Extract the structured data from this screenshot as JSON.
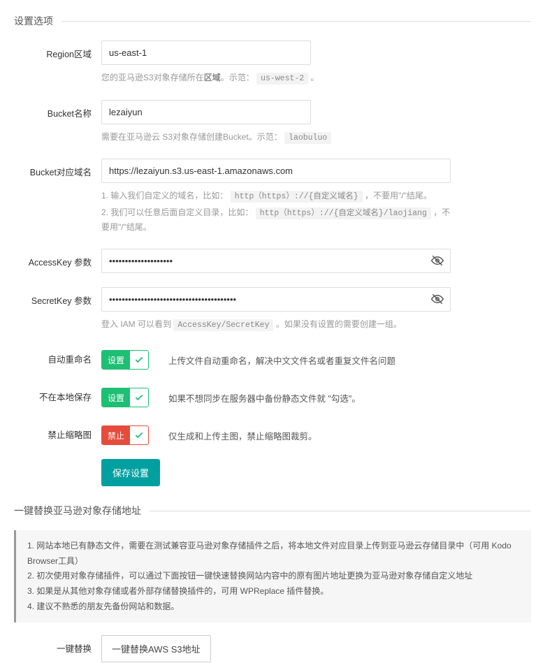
{
  "section1_title": "设置选项",
  "region": {
    "label": "Region区域",
    "value": "us-east-1",
    "hint_pre": "您的亚马逊S3对象存储所在",
    "hint_bold": "区域",
    "hint_post": "。示范：",
    "hint_code": "us-west-2",
    "hint_end": "。"
  },
  "bucket": {
    "label": "Bucket名称",
    "value": "lezaiyun",
    "hint_pre": "需要在亚马逊云 S3对象存储创建Bucket。示范：",
    "hint_code": "laobuluo"
  },
  "domain": {
    "label": "Bucket对应域名",
    "value": "https://lezaiyun.s3.us-east-1.amazonaws.com",
    "hint1_pre": "输入我们自定义的域名，比如：",
    "hint1_code": "http（https）://{自定义域名}",
    "hint1_post": "，不要用\"/\"结尾。",
    "hint2_pre": "我们可以任意后面自定义目录，比如：",
    "hint2_code": "http（https）://{自定义域名}/laojiang",
    "hint2_post": "，不要用\"/\"结尾。"
  },
  "access_key": {
    "label": "AccessKey 参数",
    "value": "••••••••••••••••••••"
  },
  "secret_key": {
    "label": "SecretKey 参数",
    "value": "••••••••••••••••••••••••••••••••••••••••",
    "hint_pre": "登入 IAM 可以看到",
    "hint_code": "AccessKey/SecretKey",
    "hint_post": "。如果没有设置的需要创建一组。"
  },
  "auto_rename": {
    "label": "自动重命名",
    "toggle": "设置",
    "desc": "上传文件自动重命名，解决中文文件名或者重复文件名问题"
  },
  "no_local": {
    "label": "不在本地保存",
    "toggle": "设置",
    "desc": "如果不想同步在服务器中备份静态文件就 \"勾选\"。"
  },
  "no_thumb": {
    "label": "禁止缩略图",
    "toggle": "禁止",
    "desc": "仅生成和上传主图，禁止缩略图裁剪。"
  },
  "save_btn": "保存设置",
  "section2_title": "一键替换亚马逊对象存储地址",
  "info_list": {
    "i1": "网站本地已有静态文件，需要在测试兼容亚马逊对象存储插件之后，将本地文件对应目录上传到亚马逊云存储目录中（可用 Kodo Browser工具）",
    "i2": "初次使用对象存储插件，可以通过下面按钮一键快速替换网站内容中的原有图片地址更换为亚马逊对象存储自定义地址",
    "i3": "如果是从其他对象存储或者外部存储替换插件的，可用 WPReplace 插件替换。",
    "i4": "建议不熟悉的朋友先备份网站和数据。"
  },
  "replace": {
    "label": "一键替换",
    "btn": "一键替换AWS S3地址"
  }
}
